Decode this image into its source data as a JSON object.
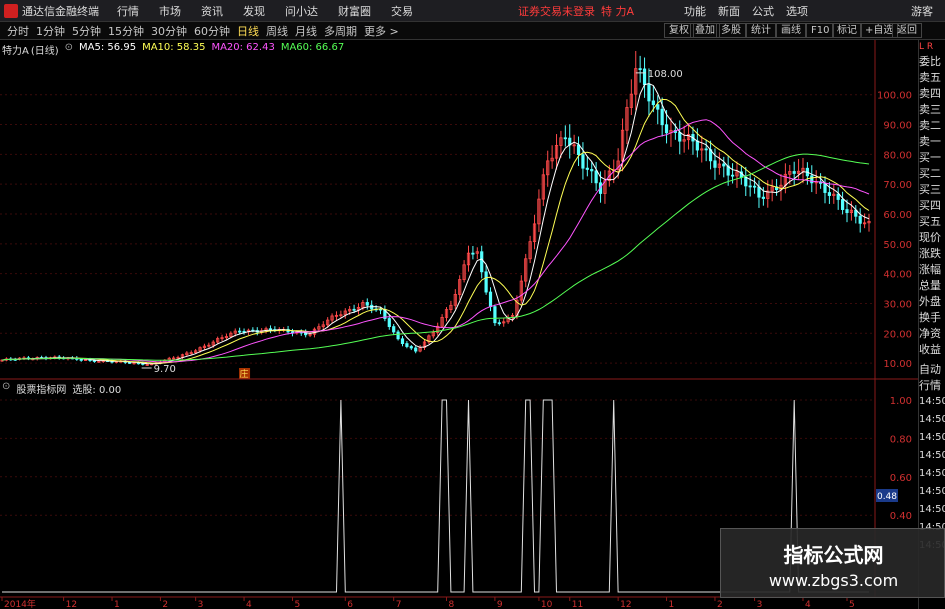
{
  "app": {
    "title": "通达信金融终端",
    "menu": [
      "行情",
      "市场",
      "资讯",
      "发现",
      "问小达",
      "财富圈",
      "交易"
    ],
    "login_warning": "证券交易未登录",
    "stock_name": "特 力A",
    "right_menu": [
      "功能",
      "新面",
      "公式",
      "选项"
    ],
    "guest": "游客"
  },
  "toolbar": {
    "periods": [
      "分时",
      "1分钟",
      "5分钟",
      "15分钟",
      "30分钟",
      "60分钟",
      "日线",
      "周线",
      "月线",
      "多周期",
      "更多 >"
    ],
    "active_period": "日线",
    "buttons": [
      "复权",
      "叠加",
      "多股",
      "统计",
      "画线",
      "F10",
      "标记",
      "+自选",
      "返回"
    ]
  },
  "legend": {
    "stock": "特力A",
    "period": "(日线)",
    "ma": [
      {
        "label": "MA5: 56.95",
        "color": "#ffffff"
      },
      {
        "label": "MA10: 58.35",
        "color": "#ffff55"
      },
      {
        "label": "MA20: 62.43",
        "color": "#ff55ff"
      },
      {
        "label": "MA60: 66.67",
        "color": "#55ff55"
      }
    ]
  },
  "indicator": {
    "name": "股票指标网",
    "label": "选股: 0.00",
    "marker": "0.48"
  },
  "annotations": {
    "high": "108.00",
    "low": "9.70",
    "badge": "庄"
  },
  "right_panel": {
    "items": [
      "委比",
      "卖五",
      "卖四",
      "卖三",
      "卖二",
      "卖一",
      "买一",
      "买二",
      "买三",
      "买四",
      "买五",
      "现价",
      "涨跌",
      "涨幅",
      "总量",
      "外盘",
      "换手",
      "净资",
      "收益"
    ],
    "bottom": [
      "自动",
      "行情"
    ],
    "times": [
      "14:50",
      "14:50",
      "14:50",
      "14:50",
      "14:50",
      "14:50",
      "14:50",
      "14:50",
      "14:50"
    ]
  },
  "watermark": {
    "title": "指标公式网",
    "url": "www.zbgs3.com"
  },
  "chart_data": {
    "type": "line",
    "title": "",
    "price_axis": {
      "ticks": [
        100,
        90,
        80,
        70,
        60,
        50,
        40,
        30,
        20,
        10
      ],
      "range": [
        5,
        115
      ]
    },
    "indicator_axis": {
      "ticks": [
        1.0,
        0.8,
        0.6,
        0.4
      ],
      "range": [
        0,
        1.0
      ]
    },
    "x_ticks": [
      {
        "label": "2014年",
        "i": 0
      },
      {
        "label": "12",
        "i": 14
      },
      {
        "label": "1",
        "i": 25
      },
      {
        "label": "2",
        "i": 36
      },
      {
        "label": "3",
        "i": 44
      },
      {
        "label": "4",
        "i": 55
      },
      {
        "label": "5",
        "i": 66
      },
      {
        "label": "6",
        "i": 78
      },
      {
        "label": "7",
        "i": 89
      },
      {
        "label": "8",
        "i": 101
      },
      {
        "label": "9",
        "i": 112
      },
      {
        "label": "10",
        "i": 122
      },
      {
        "label": "11",
        "i": 129
      },
      {
        "label": "12",
        "i": 140
      },
      {
        "label": "1",
        "i": 151
      },
      {
        "label": "2",
        "i": 162
      },
      {
        "label": "3",
        "i": 171
      },
      {
        "label": "4",
        "i": 182
      },
      {
        "label": "5",
        "i": 192
      }
    ],
    "price_keypoints": [
      [
        0,
        11
      ],
      [
        10,
        12
      ],
      [
        20,
        11
      ],
      [
        30,
        10
      ],
      [
        34,
        9.7
      ],
      [
        40,
        12
      ],
      [
        48,
        17
      ],
      [
        54,
        21
      ],
      [
        62,
        21
      ],
      [
        70,
        20
      ],
      [
        76,
        26
      ],
      [
        82,
        30
      ],
      [
        86,
        27
      ],
      [
        90,
        18
      ],
      [
        94,
        14
      ],
      [
        98,
        20
      ],
      [
        102,
        30
      ],
      [
        104,
        38
      ],
      [
        106,
        48
      ],
      [
        108,
        46
      ],
      [
        110,
        34
      ],
      [
        112,
        23
      ],
      [
        116,
        26
      ],
      [
        120,
        50
      ],
      [
        124,
        78
      ],
      [
        128,
        88
      ],
      [
        132,
        76
      ],
      [
        136,
        68
      ],
      [
        140,
        80
      ],
      [
        142,
        95
      ],
      [
        144,
        108
      ],
      [
        148,
        96
      ],
      [
        152,
        88
      ],
      [
        156,
        84
      ],
      [
        160,
        80
      ],
      [
        164,
        76
      ],
      [
        168,
        71
      ],
      [
        172,
        66
      ],
      [
        176,
        70
      ],
      [
        180,
        74
      ],
      [
        184,
        72
      ],
      [
        188,
        68
      ],
      [
        192,
        60
      ],
      [
        196,
        57
      ]
    ],
    "signals": [
      77,
      100,
      101,
      106,
      119,
      120,
      123,
      124,
      125,
      139,
      180
    ]
  }
}
